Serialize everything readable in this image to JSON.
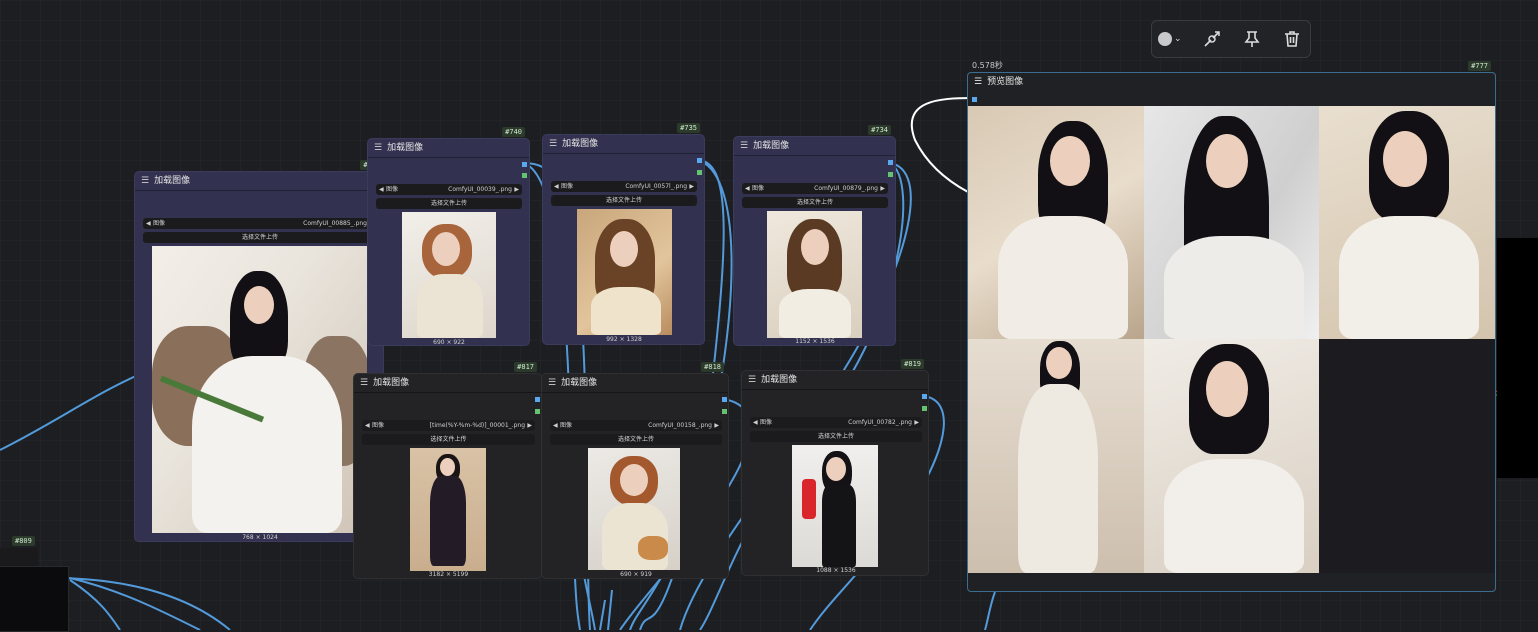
{
  "toolbar": {
    "color_icon": "color-circle-icon",
    "bypass_icon": "bypass-icon",
    "pin_icon": "pin-icon",
    "delete_icon": "trash-icon",
    "chevron": "⌄"
  },
  "nodes": {
    "n71": {
      "id": "#71",
      "title": "加载图像",
      "image_label": "图像",
      "file": "ComfyUI_00885_.png",
      "upload": "选择文件上传",
      "dims": "768 × 1024"
    },
    "n740": {
      "id": "#740",
      "title": "加载图像",
      "image_label": "图像",
      "file": "ComfyUI_00039_.png",
      "upload": "选择文件上传",
      "dims": "690 × 922"
    },
    "n735": {
      "id": "#735",
      "title": "加载图像",
      "image_label": "图像",
      "file": "ComfyUI_0057l_.png",
      "upload": "选择文件上传",
      "dims": "992 × 1328"
    },
    "n734": {
      "id": "#734",
      "title": "加载图像",
      "image_label": "图像",
      "file": "ComfyUI_00879_.png",
      "upload": "选择文件上传",
      "dims": "1152 × 1536"
    },
    "n817": {
      "id": "#817",
      "title": "加载图像",
      "image_label": "图像",
      "file": "[time(%Y-%m-%d)]_00001_.png",
      "upload": "选择文件上传",
      "dims": "3182 × 5199"
    },
    "n818": {
      "id": "#818",
      "title": "加载图像",
      "image_label": "图像",
      "file": "ComfyUI_00158_.png",
      "upload": "选择文件上传",
      "dims": "690 × 919"
    },
    "n819": {
      "id": "#819",
      "title": "加载图像",
      "image_label": "图像",
      "file": "ComfyUI_00782_.png",
      "upload": "选择文件上传",
      "dims": "1088 × 1536"
    }
  },
  "preview": {
    "id": "#777",
    "title": "预览图像",
    "timer": "0.578秒"
  },
  "side_node": {
    "id": "#809"
  },
  "colors": {
    "link": "#59a8f0",
    "node_purple": "#323250",
    "node_dark": "#232326",
    "preview_border": "#3b6d8f"
  }
}
